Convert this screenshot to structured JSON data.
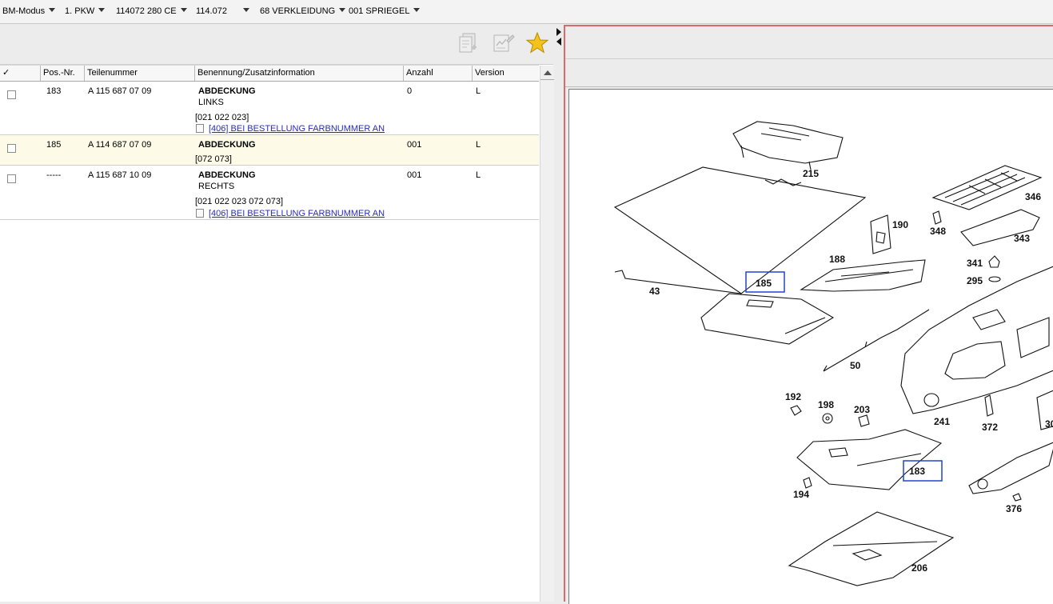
{
  "breadcrumb": [
    {
      "label": "BM-Modus"
    },
    {
      "label": "1. PKW"
    },
    {
      "label": "114072 280 CE"
    },
    {
      "label": "114.072"
    },
    {
      "label": "68 VERKLEIDUNG"
    },
    {
      "label": "001 SPRIEGEL"
    }
  ],
  "toolbar": {
    "icons": [
      "copy-list-icon",
      "edit-notes-icon",
      "favorite-star-icon"
    ]
  },
  "table": {
    "headers": {
      "check": "✓",
      "pos": "Pos.-Nr.",
      "part": "Teilenummer",
      "desc": "Benennung/Zusatzinformation",
      "qty": "Anzahl",
      "version": "Version"
    },
    "rows": [
      {
        "pos": "183",
        "part": "A 115 687 07 09",
        "name": "ABDECKUNG",
        "extra": "LINKS",
        "codes": "[021 022 023]",
        "note": "[406] BEI BESTELLUNG FARBNUMMER AN",
        "qty": "0",
        "version": "L"
      },
      {
        "pos": "185",
        "part": "A 114 687 07 09",
        "name": "ABDECKUNG",
        "extra": "",
        "codes": "[072 073]",
        "note": "",
        "qty": "001",
        "version": "L"
      },
      {
        "pos": "-----",
        "part": "A 115 687 10 09",
        "name": "ABDECKUNG",
        "extra": "RECHTS",
        "codes": "[021 022 023 072 073]",
        "note": "[406] BEI BESTELLUNG FARBNUMMER AN",
        "qty": "001",
        "version": "L"
      }
    ]
  },
  "drawing": {
    "labels": [
      "215",
      "346",
      "190",
      "348",
      "343",
      "188",
      "341",
      "295",
      "185",
      "43",
      "50",
      "192",
      "198",
      "203",
      "241",
      "372",
      "30",
      "183",
      "194",
      "376",
      "206"
    ],
    "highlighted": [
      "185",
      "183"
    ],
    "highlight_color": "#2244cc"
  },
  "colors": {
    "selected_row": "#fdfbe8",
    "link": "#2a2ac0",
    "panel_border": "#d86a6a"
  }
}
